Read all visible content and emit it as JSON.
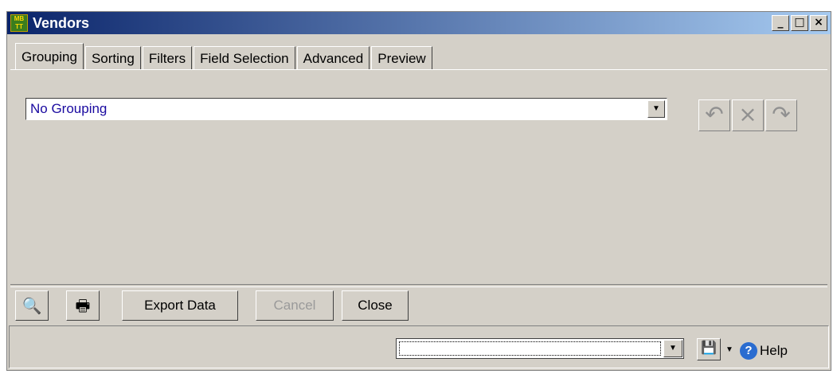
{
  "window": {
    "title": "Vendors",
    "app_icon_text": "MB TT",
    "minimize": "_",
    "maximize": "□",
    "close": "×"
  },
  "tabs": [
    {
      "label": "Grouping",
      "active": true
    },
    {
      "label": "Sorting"
    },
    {
      "label": "Filters"
    },
    {
      "label": "Field Selection"
    },
    {
      "label": "Advanced"
    },
    {
      "label": "Preview"
    }
  ],
  "grouping": {
    "selected": "No Grouping",
    "toolbar_icons": [
      "undo-icon",
      "delete-icon",
      "redo-icon"
    ]
  },
  "buttons": {
    "print_preview_icon": "print-preview-icon",
    "print_icon": "printer-icon",
    "export": "Export Data",
    "cancel": "Cancel",
    "close": "Close"
  },
  "status": {
    "combo_value": "",
    "save_icon": "floppy-icon",
    "help": "Help"
  }
}
